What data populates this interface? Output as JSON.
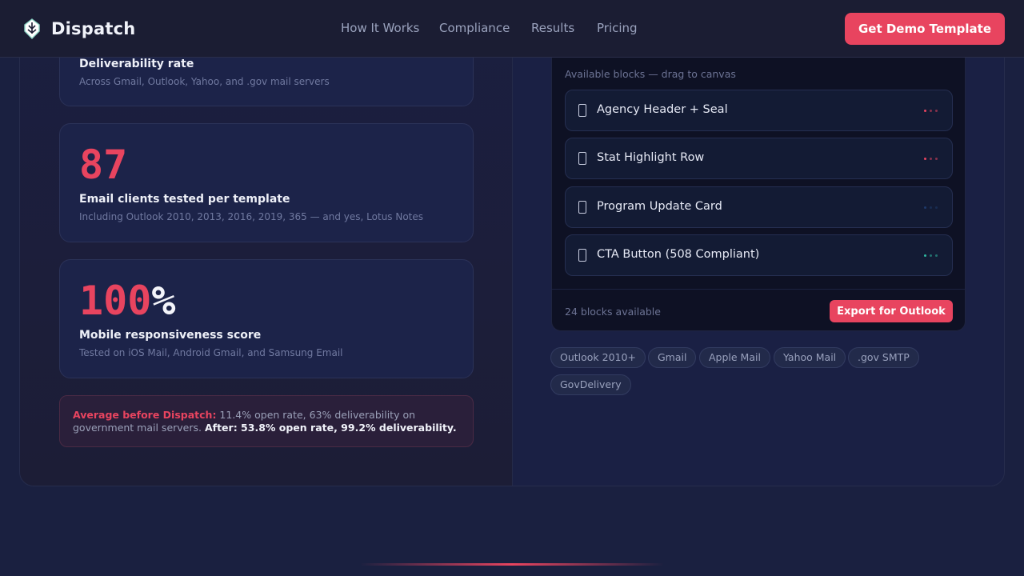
{
  "header": {
    "brand_name": "Dispatch",
    "nav": [
      "How It Works",
      "Compliance",
      "Results",
      "Pricing"
    ],
    "cta_label": "Get Demo Template"
  },
  "stats": [
    {
      "number": "",
      "unit": "",
      "title": "Deliverability rate",
      "subtitle": "Across Gmail, Outlook, Yahoo, and .gov mail servers"
    },
    {
      "number": "87",
      "unit": "",
      "title": "Email clients tested per template",
      "subtitle": "Including Outlook 2010, 2013, 2016, 2019, 365 — and yes, Lotus Notes"
    },
    {
      "number": "100",
      "unit": "%",
      "title": "Mobile responsiveness score",
      "subtitle": "Tested on iOS Mail, Android Gmail, and Samsung Email"
    }
  ],
  "note": {
    "before_label": "Average before Dispatch:",
    "before_text": " 11.4% open rate, 63% deliverability on government mail servers. ",
    "after_text": "After: 53.8% open rate, 99.2% deliverability."
  },
  "panel": {
    "hint": "Available blocks — drag to canvas",
    "blocks": [
      {
        "label": "Agency Header + Seal",
        "dot_color": "#e8445f"
      },
      {
        "label": "Stat Highlight Row",
        "dot_color": "#e8445f"
      },
      {
        "label": "Program Update Card",
        "dot_color": "#1e3a6a"
      },
      {
        "label": "CTA Button (508 Compliant)",
        "dot_color": "#2fb8a0"
      }
    ],
    "footer_count": "24 blocks available",
    "export_label": "Export for Outlook"
  },
  "chips": [
    "Outlook 2010+",
    "Gmail",
    "Apple Mail",
    "Yahoo Mail",
    ".gov SMTP",
    "GovDelivery"
  ],
  "colors": {
    "accent": "#e8445f",
    "background": "#1a2040",
    "header": "#1b1d33"
  }
}
